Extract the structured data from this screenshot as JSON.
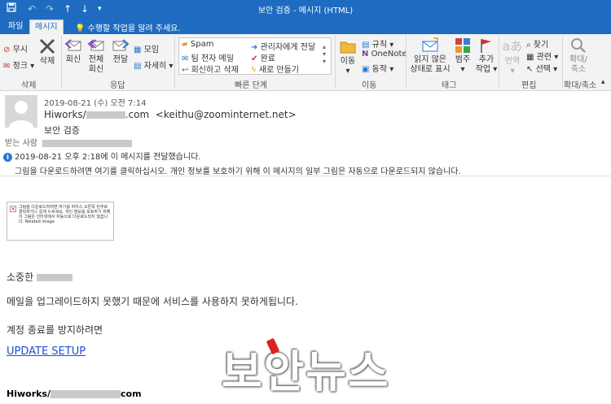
{
  "window": {
    "title": "보안 검증 - 메시지 (HTML)"
  },
  "tabs": [
    {
      "label": "파일"
    },
    {
      "label": "메시지"
    }
  ],
  "tell_me": "수행할 작업을 알려 주세요.",
  "ribbon": {
    "delete_group": {
      "ignore": "무시",
      "cleanup": "정크",
      "delete": "삭제",
      "label": "삭제"
    },
    "respond_group": {
      "reply": "회신",
      "reply_all_1": "전체",
      "reply_all_2": "회신",
      "forward": "전달",
      "meeting": "모임",
      "more": "자세히",
      "label": "응답"
    },
    "quick_steps": {
      "items": [
        "Spam",
        "팀 전자 메일",
        "회신하고 삭제",
        "관리자에게 전달",
        "완료",
        "새로 만들기"
      ],
      "label": "빠른 단계"
    },
    "move_group": {
      "move": "이동",
      "rules": "규칙",
      "onenote": "OneNote",
      "actions": "동작",
      "label": "이동"
    },
    "tags_group": {
      "unread_1": "읽지 않은",
      "unread_2": "상태로 표시",
      "categorize": "범주",
      "followup_1": "추가",
      "followup_2": "작업",
      "label": "태그"
    },
    "editing_group": {
      "translate": "번역",
      "find": "찾기",
      "related": "관련",
      "select": "선택",
      "label": "편집"
    },
    "zoom_group": {
      "zoom_1": "확대/",
      "zoom_2": "축소",
      "label": "확대/축소"
    }
  },
  "message": {
    "date": "2019-08-21 (수) 오전 7:14",
    "from_prefix": "Hiworks/",
    "from_domain": ".com",
    "from_email": "<keithu@zoominternet.net>",
    "subject": "보안 검증",
    "to_label": "받는 사람",
    "info_line_1": "2019-08-21 오후 2:18에 이 메시지를 전달했습니다.",
    "info_line_2": "그림을 다운로드하려면 여기를 클릭하십시오. 개인 정보를 보호하기 위해 이 메시지의 일부 그림은 자동으로 다운로드되지 않습니다.",
    "image_placeholder": "그림을 다운로드하려면 여기를 마우스 오른쪽 단추로 클릭하거나 길게 누르세요. 개인 정보를 보호하기 위해 이 그림은 인터넷에서 자동으로 다운로드되지 않습니다. Related image",
    "greeting": "소중한",
    "line_1": "메일을 업그레이드하지 못했기 때문에 서비스를 사용하지 못하게됩니다.",
    "line_2": "계정 종료를 방지하려면",
    "link_text": "UPDATE SETUP",
    "signature_prefix": "Hiworks/",
    "signature_suffix": "com"
  },
  "watermark": "보안뉴스",
  "colors": {
    "accent": "#1e6bc1",
    "link": "#1f4fd1"
  }
}
